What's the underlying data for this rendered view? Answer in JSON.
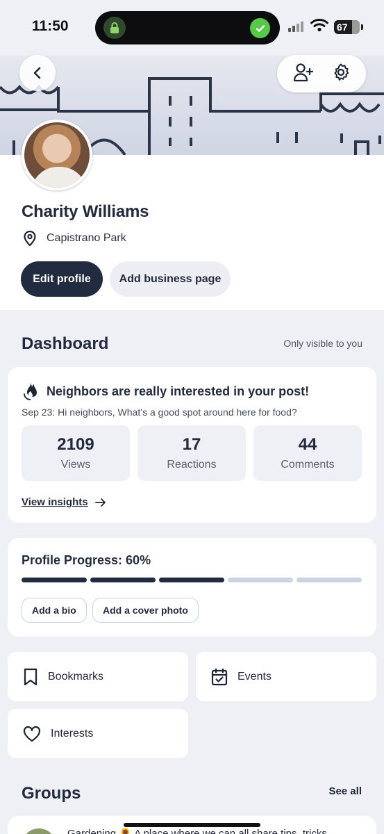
{
  "status_bar": {
    "time": "11:50",
    "battery": "67"
  },
  "header": {
    "back_icon": "chevron-left-icon",
    "add_friend_icon": "person-add-icon",
    "settings_icon": "gear-icon"
  },
  "profile": {
    "name": "Charity Williams",
    "location": "Capistrano Park",
    "edit_label": "Edit profile",
    "business_label": "Add business page"
  },
  "dashboard": {
    "title": "Dashboard",
    "note": "Only visible to you",
    "post_card": {
      "headline": "Neighbors are really interested in your post!",
      "post_excerpt": "Sep 23: Hi neighbors, What’s a good spot around here for food?",
      "stats": [
        {
          "value": "2109",
          "label": "Views"
        },
        {
          "value": "17",
          "label": "Reactions"
        },
        {
          "value": "44",
          "label": "Comments"
        }
      ],
      "insights_label": "View insights"
    },
    "progress": {
      "title": "Profile Progress: 60%",
      "percent": 60,
      "segments": 5,
      "actions": [
        "Add a bio",
        "Add a cover photo"
      ]
    }
  },
  "shortcuts": [
    {
      "label": "Bookmarks",
      "icon": "bookmark-icon"
    },
    {
      "label": "Events",
      "icon": "calendar-icon"
    },
    {
      "label": "Interests",
      "icon": "heart-icon"
    }
  ],
  "groups": {
    "title": "Groups",
    "see_all": "See all",
    "first_item_text": "Gardening 🌻 A place where we can all share tips, tricks"
  },
  "colors": {
    "accent_dark": "#222b3f",
    "background": "#eef0f5",
    "progress_inactive": "#cdd3e3"
  }
}
